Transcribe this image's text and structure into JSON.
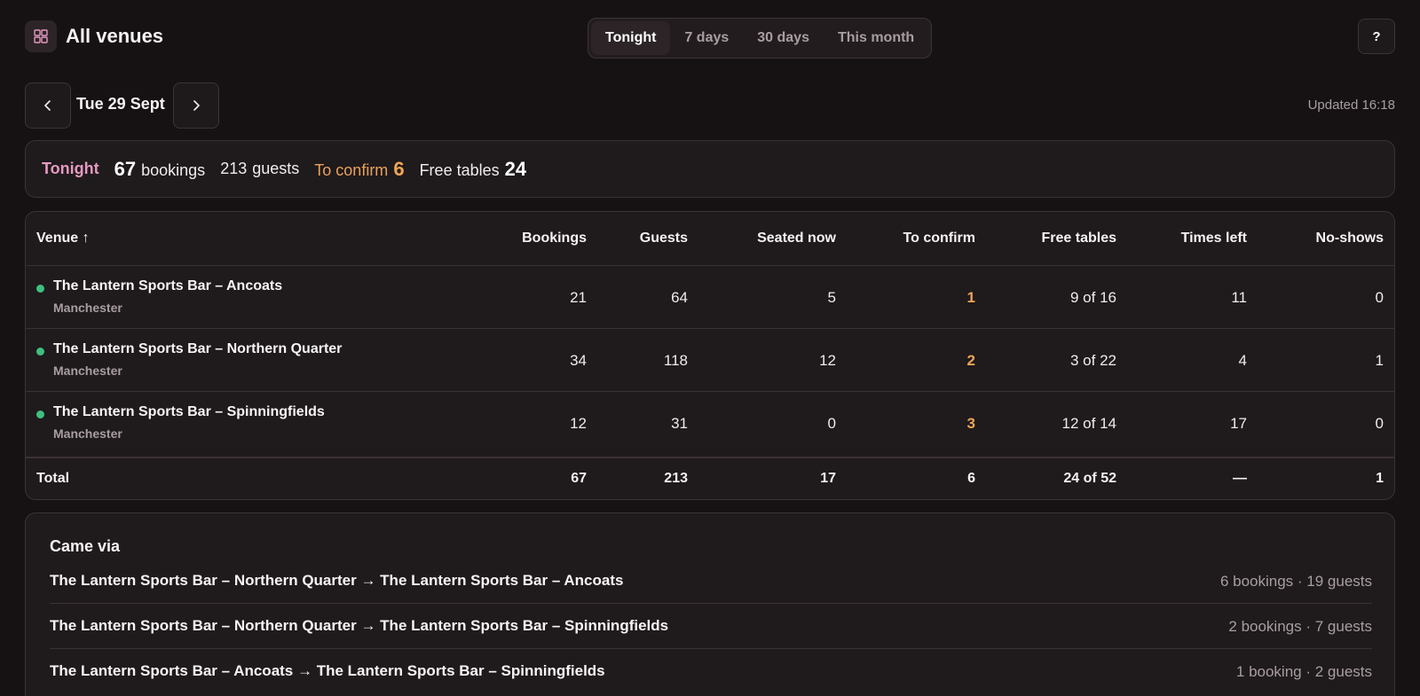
{
  "header": {
    "title": "All venues",
    "icon": "grid-icon",
    "tabs": [
      {
        "label": "Tonight",
        "active": true
      },
      {
        "label": "7 days",
        "active": false
      },
      {
        "label": "30 days",
        "active": false
      },
      {
        "label": "This month",
        "active": false
      }
    ],
    "help_label": "?"
  },
  "date_nav": {
    "date": "Tue 29 Sept",
    "updated": "Updated 16:18"
  },
  "summary": {
    "period": "Tonight",
    "bookings_value": "67",
    "bookings_label": "bookings",
    "guests_value": "213",
    "guests_label": "guests",
    "confirm_label": "To confirm",
    "confirm_value": "6",
    "free_label": "Free tables",
    "free_value": "24"
  },
  "table": {
    "headers": {
      "venue": "Venue ↑",
      "bookings": "Bookings",
      "guests": "Guests",
      "seated": "Seated now",
      "confirm": "To confirm",
      "free": "Free tables",
      "times": "Times left",
      "noshows": "No-shows"
    },
    "rows": [
      {
        "name": "The Lantern Sports Bar – Ancoats",
        "city": "Manchester",
        "bookings": "21",
        "guests": "64",
        "seated": "5",
        "confirm": "1",
        "free": "9 of 16",
        "times": "11",
        "noshows": "0"
      },
      {
        "name": "The Lantern Sports Bar – Northern Quarter",
        "city": "Manchester",
        "bookings": "34",
        "guests": "118",
        "seated": "12",
        "confirm": "2",
        "free": "3 of 22",
        "times": "4",
        "noshows": "1"
      },
      {
        "name": "The Lantern Sports Bar – Spinningfields",
        "city": "Manchester",
        "bookings": "12",
        "guests": "31",
        "seated": "0",
        "confirm": "3",
        "free": "12 of 14",
        "times": "17",
        "noshows": "0"
      }
    ],
    "total": {
      "label": "Total",
      "bookings": "67",
      "guests": "213",
      "seated": "17",
      "confirm": "6",
      "free": "24 of 52",
      "times": "—",
      "noshows": "1"
    }
  },
  "came_via": {
    "title": "Came via",
    "items": [
      {
        "route": "The Lantern Sports Bar – Northern Quarter → The Lantern Sports Bar – Ancoats",
        "stats": "6 bookings · 19 guests"
      },
      {
        "route": "The Lantern Sports Bar – Northern Quarter → The Lantern Sports Bar – Spinningfields",
        "stats": "2 bookings · 7 guests"
      },
      {
        "route": "The Lantern Sports Bar – Ancoats → The Lantern Sports Bar – Spinningfields",
        "stats": "1 booking · 2 guests"
      }
    ]
  },
  "colors": {
    "background": "#161213",
    "card": "#1f1a1c",
    "accent_pink": "#e59ac0",
    "accent_orange": "#f0a556",
    "status_green": "#3fbf7f"
  }
}
